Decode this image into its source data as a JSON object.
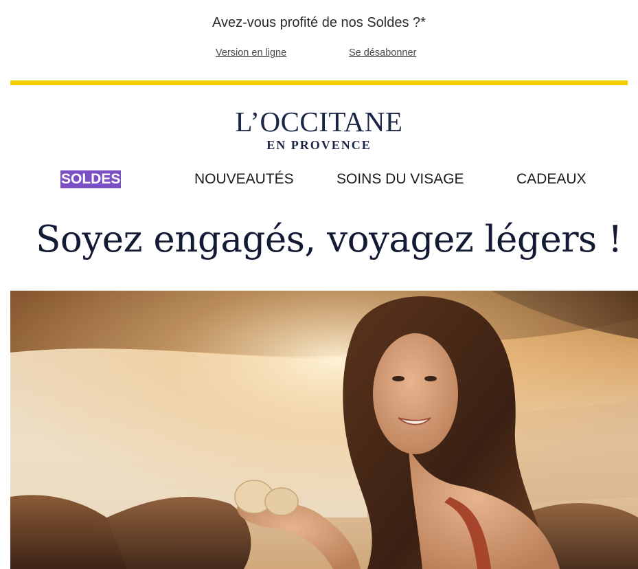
{
  "preheader": {
    "text": "Avez-vous profité de nos Soldes ?*",
    "online_version": "Version en ligne",
    "unsubscribe": "Se désabonner"
  },
  "brand": {
    "name": "L’OCCITANE",
    "subtitle": "EN PROVENCE",
    "accent_color": "#f5cf00",
    "logo_color": "#1b2545"
  },
  "nav": {
    "items": [
      {
        "label": "SOLDES",
        "highlight_color": "#7b4fc4"
      },
      {
        "label": "NOUVEAUTÉS"
      },
      {
        "label": "SOINS DU VISAGE"
      },
      {
        "label": "CADEAUX"
      }
    ]
  },
  "headline": "Soyez engagés, voyagez légers !",
  "hero": {
    "image": "woman-holding-soap-on-rocky-beach-at-sunset"
  }
}
